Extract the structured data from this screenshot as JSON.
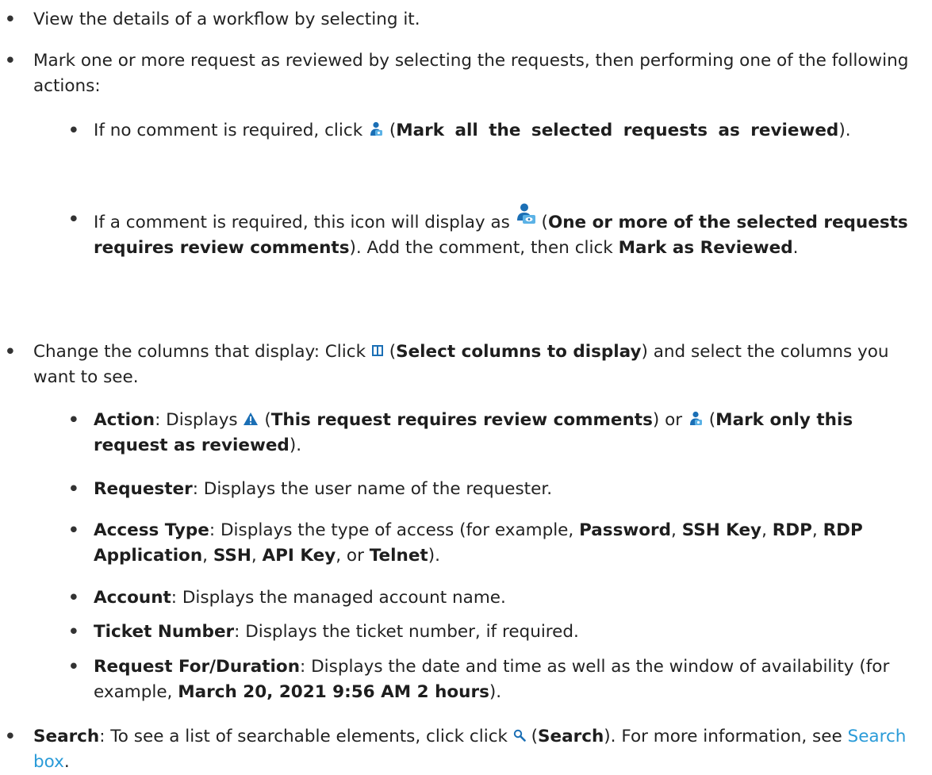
{
  "bullet_char": "•",
  "items": {
    "view": {
      "text": "View the details of a workflow by selecting it."
    },
    "mark": {
      "text": "Mark one or more request as reviewed by selecting the requests, then performing one of the following actions:",
      "no_comment": {
        "pre": "If no comment is required, click ",
        "open": " (",
        "bold": "Mark all the selected requests as reviewed",
        "close": ")."
      },
      "comment_required": {
        "pre": "If a comment is required, this icon will display as ",
        "open": " (",
        "bold": "One or more of the selected requests requires review comments",
        "mid": "). Add the comment, then click ",
        "bold2": "Mark as Reviewed",
        "end": "."
      }
    },
    "columns": {
      "pre": "Change the columns that display: Click ",
      "open": " (",
      "bold": "Select columns to display",
      "post": ") and select the columns you want to see.",
      "action": {
        "label": "Action",
        "pre": ": Displays ",
        "open": " (",
        "bold": "This request requires review comments",
        "or": ") or ",
        "open2": " (",
        "bold2": "Mark only this request as reviewed",
        "end": ")."
      },
      "requester": {
        "label": "Requester",
        "text": ": Displays the user name of the requester."
      },
      "access_type": {
        "label": "Access Type",
        "text": ": Displays the type of access (for example, ",
        "values": [
          "Password",
          "SSH Key",
          "RDP",
          "RDP Application",
          "SSH",
          "API Key"
        ],
        "sep": ", ",
        "or": ", or ",
        "last": "Telnet",
        "end": ")."
      },
      "account": {
        "label": "Account",
        "text": ": Displays the managed account name."
      },
      "ticket": {
        "label": "Ticket Number",
        "text": ": Displays the ticket number, if required."
      },
      "request_for": {
        "label": "Request For/Duration",
        "text": ": Displays the date and time as well as the window of availability (for example, ",
        "example": "March 20, 2021 9:56 AM 2 hours",
        "end": ")."
      }
    },
    "search": {
      "label": "Search",
      "pre": ": To see a list of searchable elements, click click ",
      "open": " (",
      "bold": "Search",
      "post": "). For more information, see ",
      "link": "Search box",
      "end": "."
    }
  },
  "icons": {
    "reviewer": "person-reviewed-icon",
    "reviewer_comment": "person-comment-required-icon",
    "columns": "select-columns-icon",
    "warning": "warning-triangle-icon",
    "search": "magnifier-icon"
  },
  "colors": {
    "text": "#222222",
    "link": "#2a9bd8",
    "icon_blue": "#1b6fb5",
    "icon_light_blue": "#5bb2e6"
  }
}
